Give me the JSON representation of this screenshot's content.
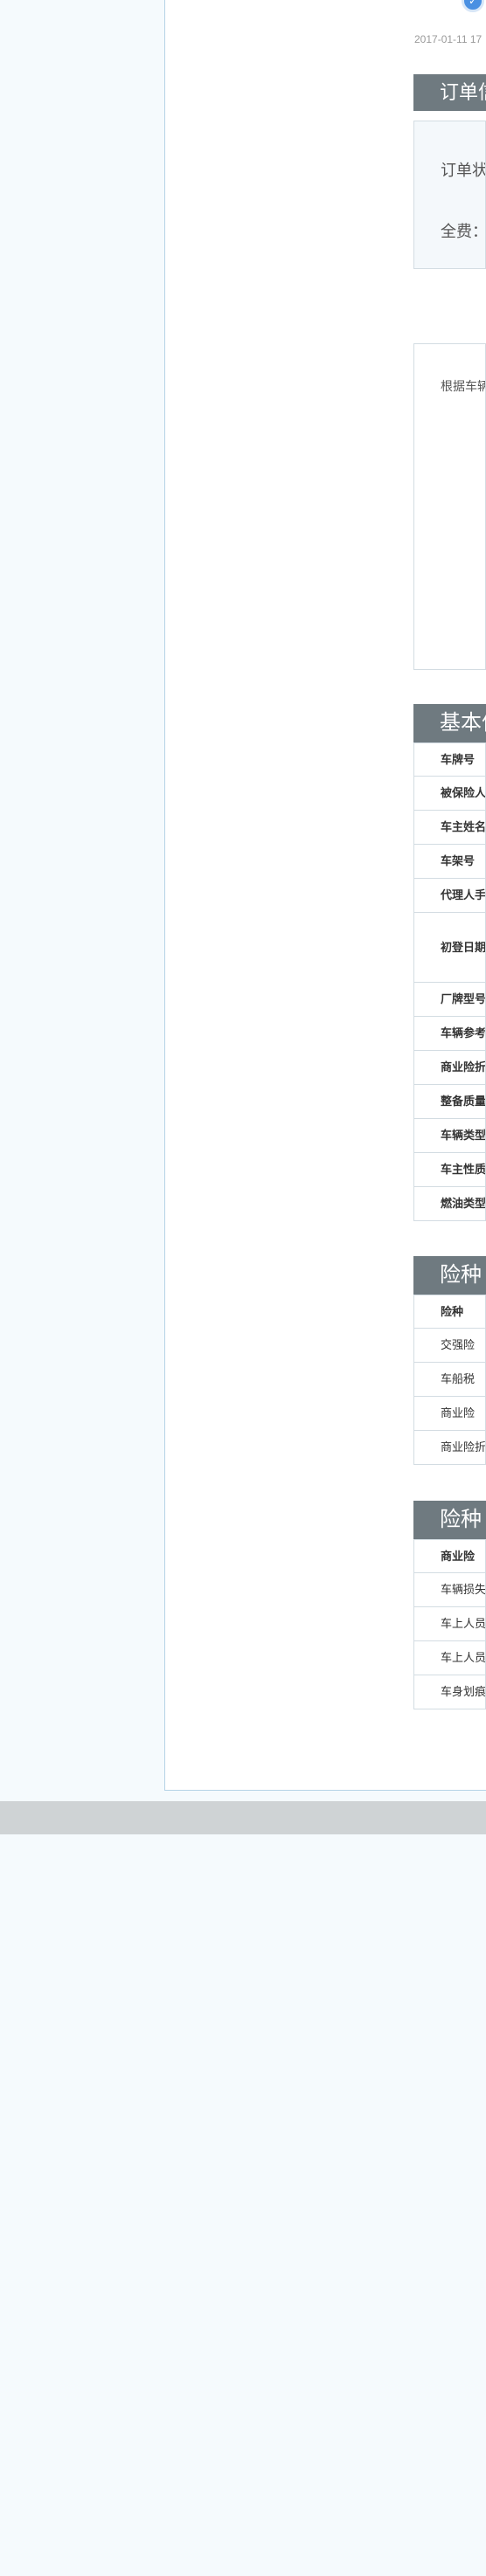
{
  "timestamp": "2017-01-11 17",
  "order_section": {
    "title": "订单信",
    "status_label": "订单状",
    "fee_label": "全费："
  },
  "note_section": {
    "text": "根据车辆"
  },
  "basic_info": {
    "title": "基本信",
    "rows": [
      "车牌号",
      "被保险人",
      "车主姓名",
      "车架号",
      "代理人手",
      "初登日期",
      "厂牌型号",
      "车辆参考",
      "商业险折",
      "整备质量",
      "车辆类型",
      "车主性质",
      "燃油类型"
    ]
  },
  "insurance_table1": {
    "title": "险种",
    "header": "险种",
    "rows": [
      "交强险",
      "车船税",
      "商业险",
      "商业险折"
    ]
  },
  "insurance_table2": {
    "title": "险种",
    "header": "商业险",
    "rows": [
      "车辆损失",
      "车上人员",
      "车上人员",
      "车身划痕"
    ]
  },
  "icons": {
    "check": "check-circle-icon"
  }
}
